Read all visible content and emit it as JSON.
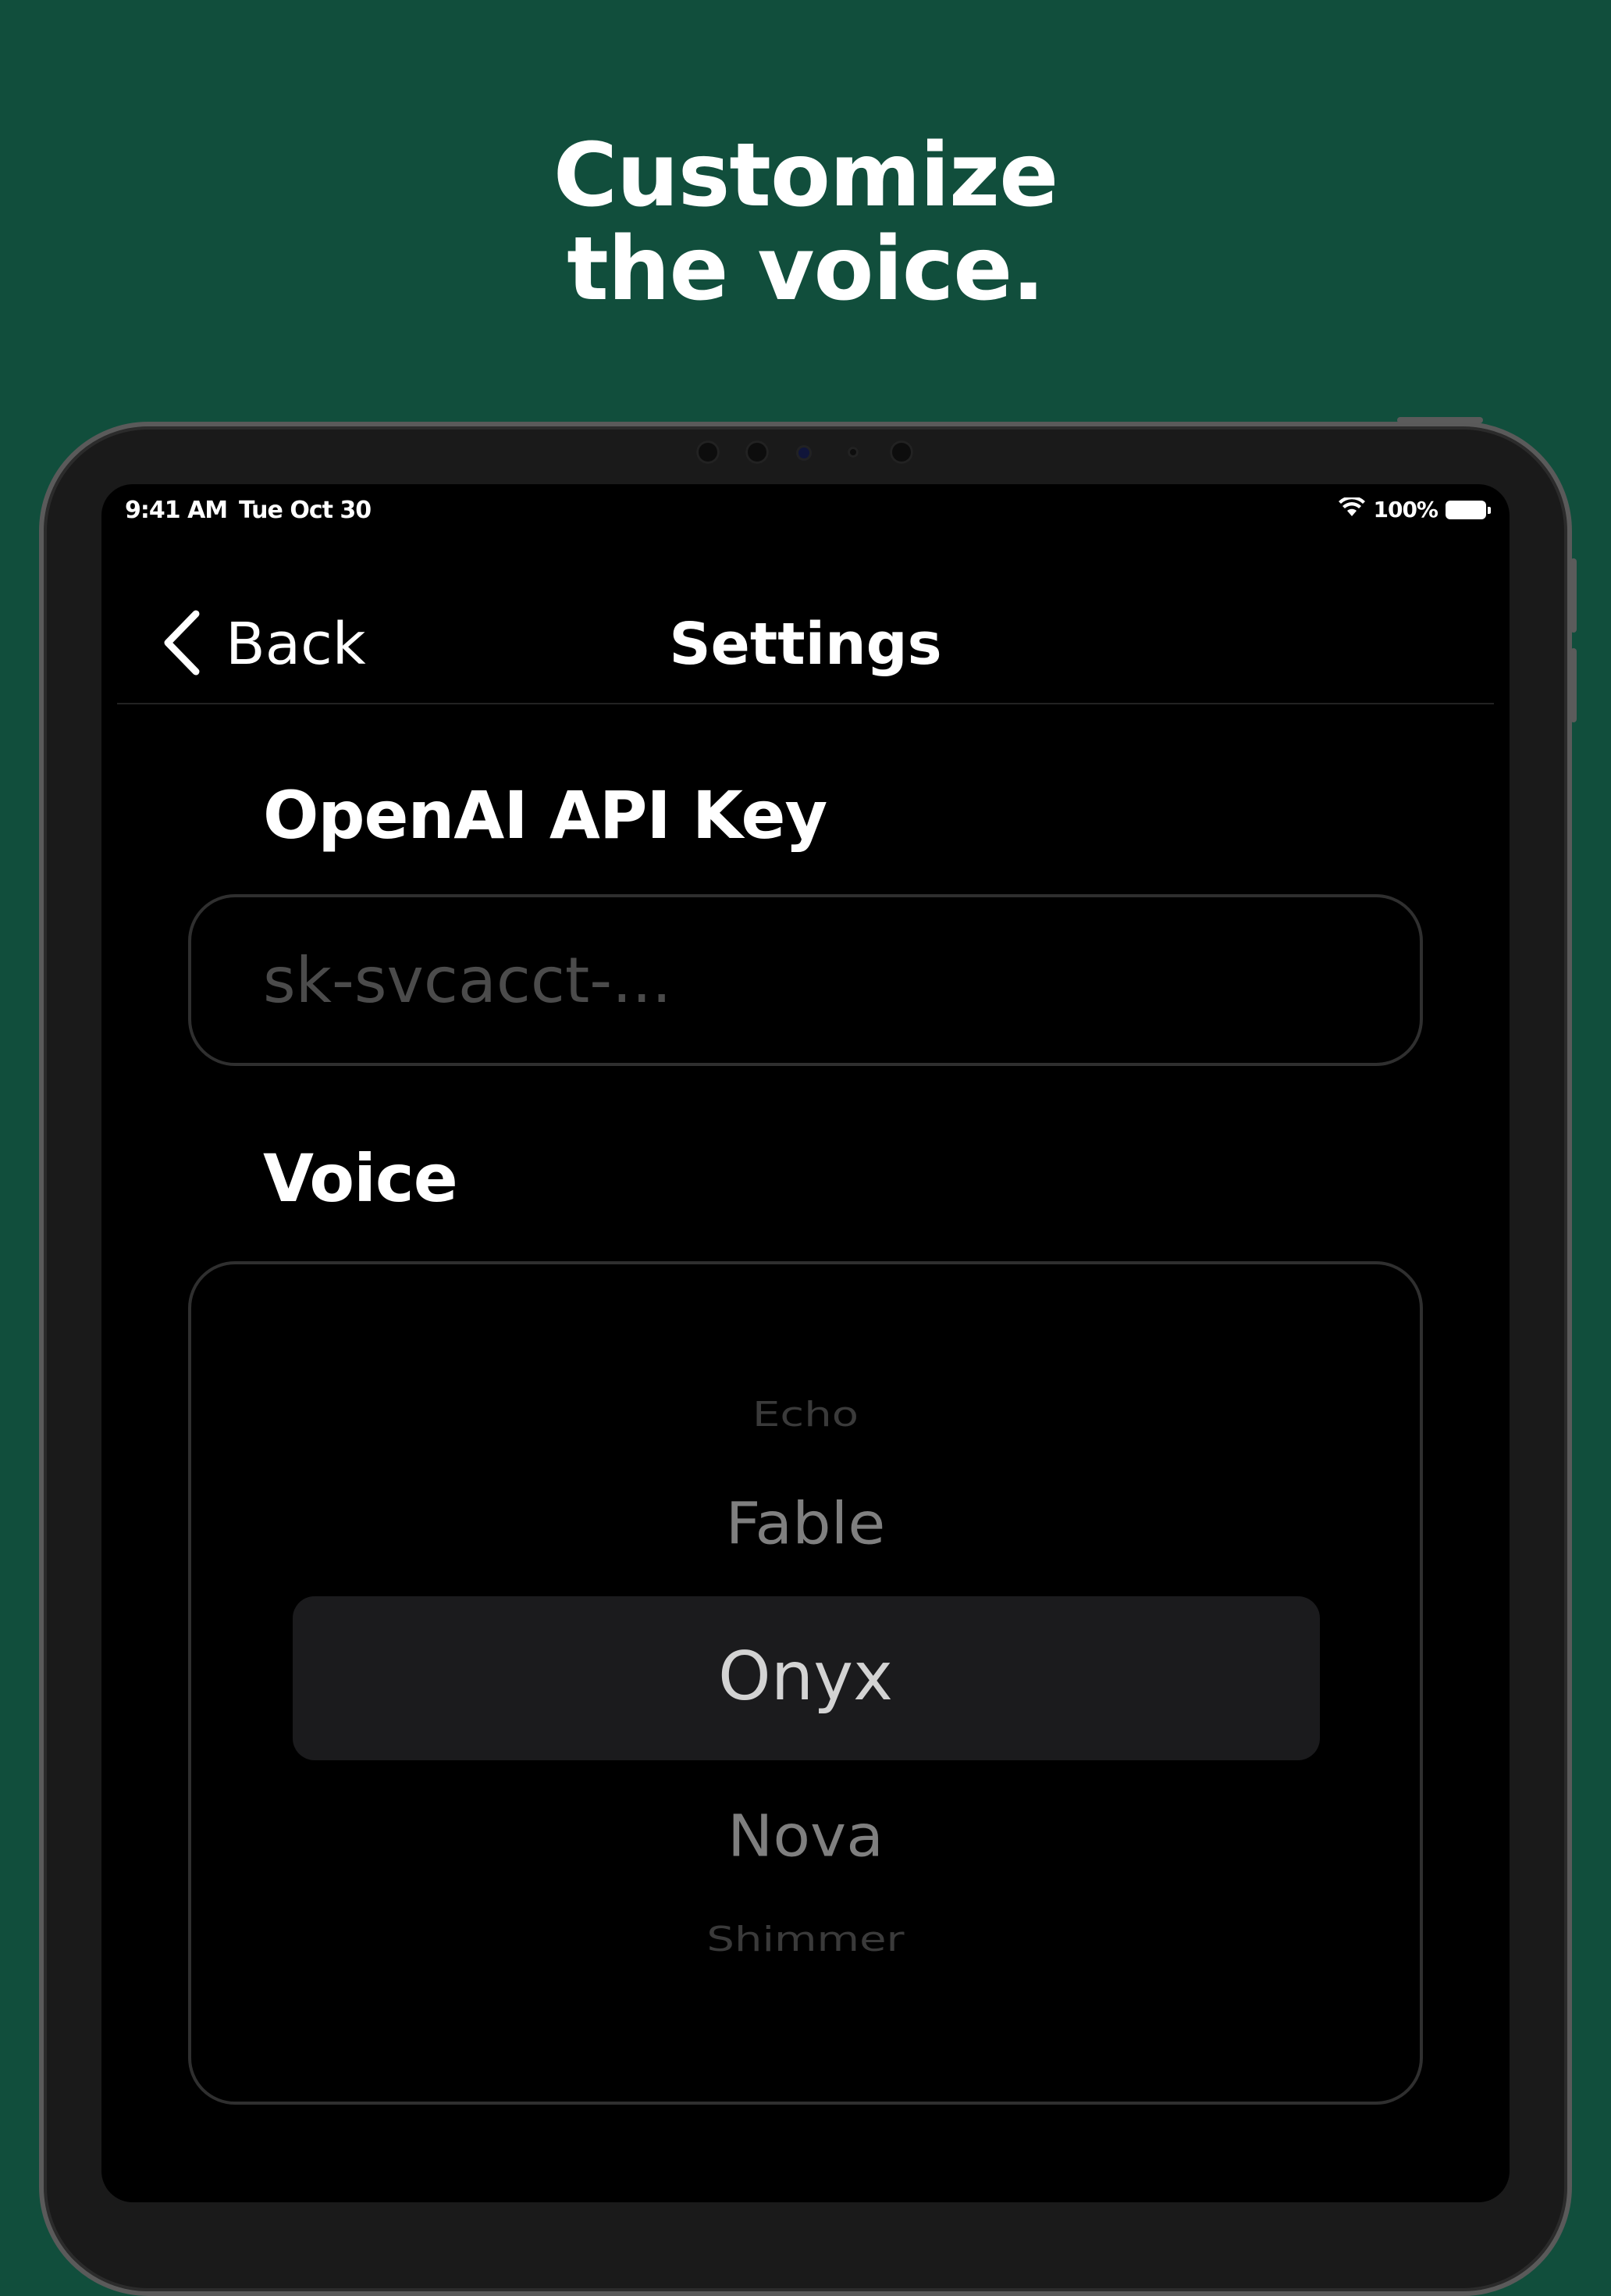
{
  "headline": {
    "line1": "Customize",
    "line2": "the voice."
  },
  "status_bar": {
    "time": "9:41 AM",
    "date": "Tue Oct 30",
    "battery_percent": "100%",
    "icons": [
      "wifi-icon",
      "battery-icon"
    ]
  },
  "nav": {
    "back_label": "Back",
    "title": "Settings"
  },
  "api_key": {
    "label": "OpenAI API Key",
    "value": "",
    "placeholder": "sk-svcacct-..."
  },
  "voice": {
    "label": "Voice",
    "options": [
      "Echo",
      "Fable",
      "Onyx",
      "Nova",
      "Shimmer"
    ],
    "selected": "Onyx"
  },
  "colors": {
    "background": "#114e3c",
    "screen": "#000000",
    "selection": "#1b1b1d"
  }
}
